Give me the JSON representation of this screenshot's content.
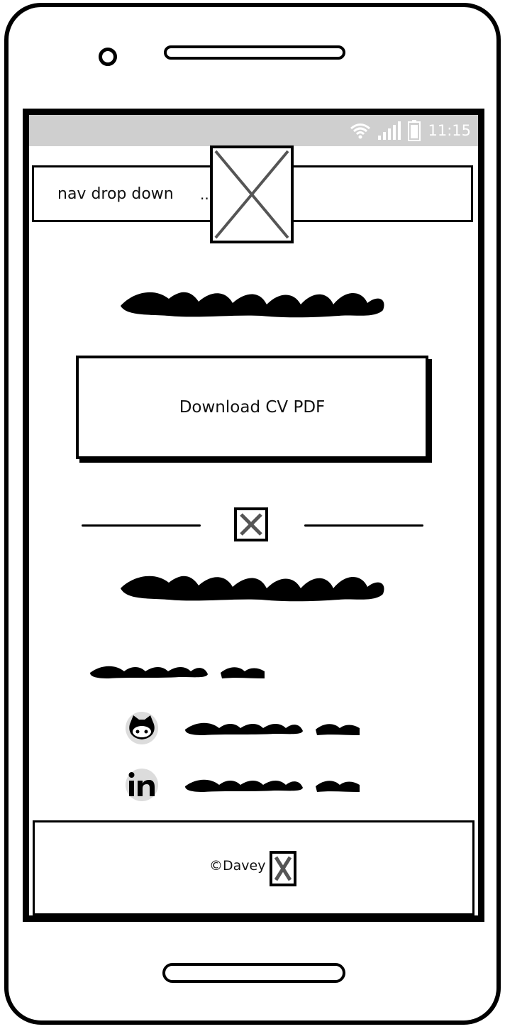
{
  "status_bar": {
    "time": "11:15",
    "icons": [
      "wifi-icon",
      "signal-icon",
      "battery-icon"
    ]
  },
  "nav": {
    "label": "nav drop down",
    "overflow": ".."
  },
  "logo": {
    "icon": "image-placeholder-icon"
  },
  "main": {
    "download_button": "Download CV PDF",
    "divider_icon": "image-placeholder-icon"
  },
  "social": [
    {
      "icon": "github-icon"
    },
    {
      "icon": "linkedin-icon"
    }
  ],
  "footer": {
    "copyright": "©Davey",
    "icon": "image-placeholder-icon"
  },
  "colors": {
    "ink": "#000000",
    "status_bar": "#cfcfcf",
    "placeholder_x": "#555555"
  }
}
